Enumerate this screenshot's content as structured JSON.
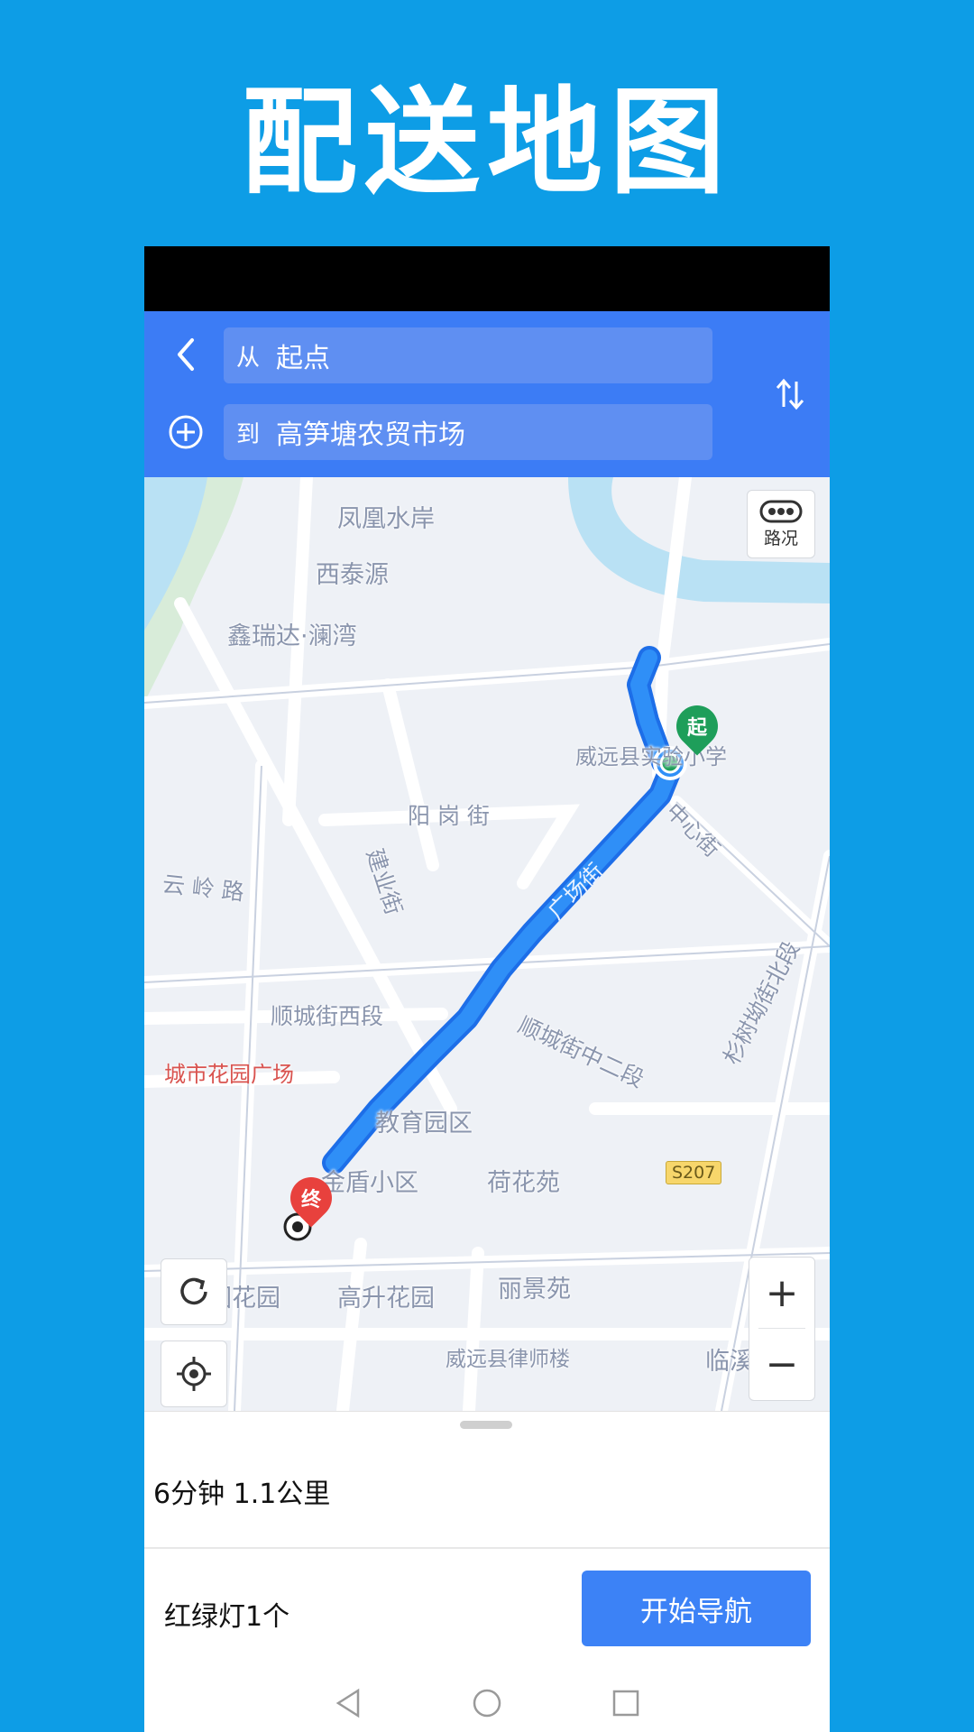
{
  "promo": {
    "title": "配送地图"
  },
  "header": {
    "from_prefix": "从",
    "from_value": "起点",
    "to_prefix": "到",
    "to_value": "高笋塘农贸市场"
  },
  "map": {
    "traffic_label": "路况",
    "labels": {
      "fenghuang": "凤凰水岸",
      "xitai": "西泰源",
      "xinruida": "鑫瑞达·澜湾",
      "school": "威远县实验小学",
      "zhongxin": "中心街",
      "yanggang": "阳 岗 街",
      "yunling": "云 岭 路",
      "jianye": "建业街",
      "guangchang": "广场街",
      "shuncheng_west": "顺城街西段",
      "shuncheng_mid": "顺城街中二段",
      "shanshu": "杉树坳街北段",
      "chengshi": "城市花园广场",
      "jiaoyu": "教育园区",
      "jindun": "金盾小区",
      "hehua": "荷花苑",
      "s207": "S207",
      "huayuan": "园花园",
      "gaosheng": "高升花园",
      "lijing": "丽景苑",
      "lawyer": "威远县律师楼",
      "linxi": "临溪小区"
    },
    "start_marker": "起",
    "end_marker": "终"
  },
  "sheet": {
    "route_summary": "6分钟 1.1公里",
    "traffic_lights": "红绿灯1个",
    "nav_button": "开始导航"
  }
}
